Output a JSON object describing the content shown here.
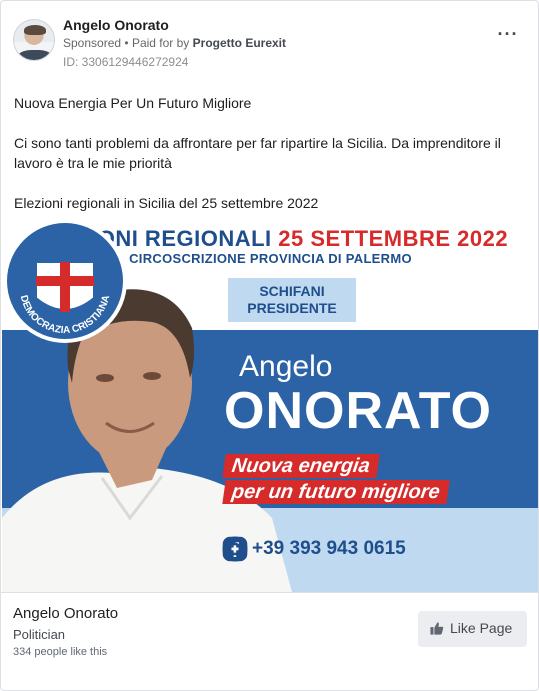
{
  "header": {
    "page_name": "Angelo Onorato",
    "sponsored": "Sponsored",
    "paid_prefix": "Paid for by",
    "paid_by": "Progetto Eurexit",
    "ad_id": "ID: 3306129446272924",
    "more_icon": "more-horizontal-icon"
  },
  "post": {
    "headline": "Nuova Energia Per Un Futuro Migliore",
    "paragraph": "Ci sono tanti problemi da affrontare per far ripartire la Sicilia. Da imprenditore il lavoro è tra le mie priorità",
    "event": "Elezioni regionali in Sicilia del 25 settembre 2022"
  },
  "creative": {
    "title_part1": "ELEZIONI REGIONALI",
    "title_part2": "25 SETTEMBRE 2022",
    "subtitle": "CIRCOSCRIZIONE PROVINCIA DI PALERMO",
    "schifani_line1": "SCHIFANI",
    "schifani_line2": "PRESIDENTE",
    "candidate_first": "Angelo",
    "candidate_last": "ONORATO",
    "slogan_line1": "Nuova energia",
    "slogan_line2": "per un futuro migliore",
    "phone": "+39 393 943 0615",
    "logo_top": "DC",
    "logo_ring_text": "DEMOCRAZIA CRISTIANA",
    "colors": {
      "blue": "#1f4e8c",
      "band_blue": "#2b63a6",
      "light_blue": "#bfd9f0",
      "red": "#d62b2b"
    }
  },
  "footer": {
    "page_name": "Angelo Onorato",
    "category": "Politician",
    "likes": "334 people like this",
    "like_button": "Like Page"
  }
}
